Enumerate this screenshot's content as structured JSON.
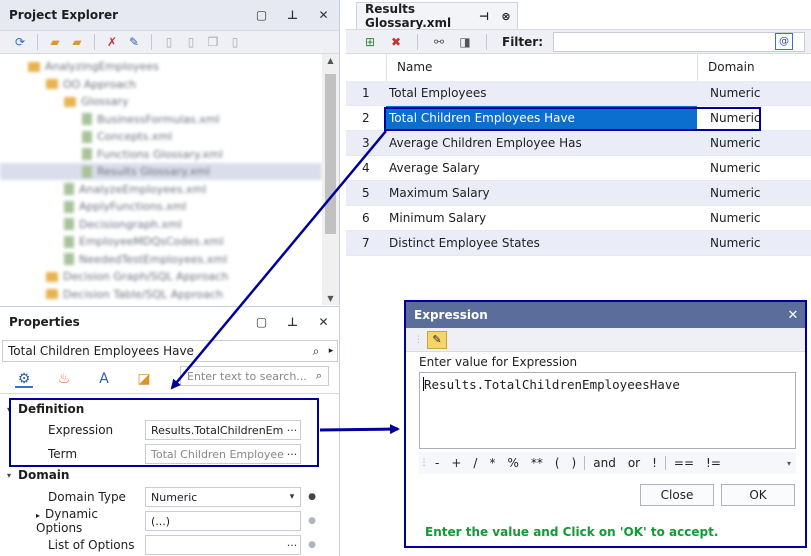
{
  "project_explorer": {
    "title": "Project Explorer",
    "header_buttons": {
      "dock_icon": "□",
      "pin_icon": "📌",
      "close_icon": "✕"
    },
    "tree_items": [
      {
        "label": "AnalyzingEmployees",
        "depth": 1,
        "kind": "folder"
      },
      {
        "label": "OO Approach",
        "depth": 2,
        "kind": "folder"
      },
      {
        "label": "Glossary",
        "depth": 3,
        "kind": "folder"
      },
      {
        "label": "BusinessFormulas.xml",
        "depth": 4,
        "kind": "file"
      },
      {
        "label": "Concepts.xml",
        "depth": 4,
        "kind": "file"
      },
      {
        "label": "Functions Glossary.xml",
        "depth": 4,
        "kind": "file"
      },
      {
        "label": "Results Glossary.xml",
        "depth": 4,
        "kind": "file"
      },
      {
        "label": "AnalyzeEmployees.xml",
        "depth": 3,
        "kind": "file"
      },
      {
        "label": "ApplyFunctions.xml",
        "depth": 3,
        "kind": "file"
      },
      {
        "label": "Decisiongraph.xml",
        "depth": 3,
        "kind": "file"
      },
      {
        "label": "EmployeeMDQsCodes.xml",
        "depth": 3,
        "kind": "file"
      },
      {
        "label": "NeededTestEmployees.xml",
        "depth": 3,
        "kind": "file"
      },
      {
        "label": "Decision Graph/SQL Approach",
        "depth": 2,
        "kind": "folder"
      },
      {
        "label": "Decision Table/SQL Approach",
        "depth": 2,
        "kind": "folder"
      }
    ]
  },
  "properties": {
    "title": "Properties",
    "selected_object": "Total Children Employees Have",
    "search_placeholder": "Enter text to search...",
    "categories": [
      {
        "name": "Definition",
        "rows": [
          {
            "name": "Expression",
            "value": "Results.TotalChildrenEmp",
            "button": "···"
          },
          {
            "name": "Term",
            "value": "Total Children Employees",
            "button": "···"
          }
        ]
      },
      {
        "name": "Domain",
        "rows": [
          {
            "name": "Domain Type",
            "value": "Numeric",
            "button": "▾"
          },
          {
            "name": "Dynamic Options",
            "value": "(...)",
            "button": ""
          },
          {
            "name": "List of Options",
            "value": "",
            "button": "···"
          }
        ]
      }
    ]
  },
  "document": {
    "tab_title": "Results Glossary.xml",
    "filter_label": "Filter:",
    "filter_value": "",
    "columns": {
      "name": "Name",
      "domain": "Domain"
    },
    "rows": [
      {
        "idx": "1",
        "name": "Total Employees",
        "domain": "Numeric"
      },
      {
        "idx": "2",
        "name": "Total Children Employees Have",
        "domain": "Numeric"
      },
      {
        "idx": "3",
        "name": "Average Children Employee Has",
        "domain": "Numeric"
      },
      {
        "idx": "4",
        "name": "Average Salary",
        "domain": "Numeric"
      },
      {
        "idx": "5",
        "name": "Maximum Salary",
        "domain": "Numeric"
      },
      {
        "idx": "6",
        "name": "Minimum Salary",
        "domain": "Numeric"
      },
      {
        "idx": "7",
        "name": "Distinct Employee States",
        "domain": "Numeric"
      }
    ]
  },
  "expression_dialog": {
    "title": "Expression",
    "label": "Enter value for Expression",
    "value": "Results.TotalChildrenEmployeesHave",
    "operators": [
      "-",
      "+",
      "/",
      "*",
      "%",
      "**",
      "(",
      ")",
      "and",
      "or",
      "!",
      "==",
      "!="
    ],
    "close_label": "Close",
    "ok_label": "OK",
    "hint": "Enter the value and Click on 'OK' to accept."
  },
  "colors": {
    "annotation": "#000099",
    "selection": "#0a6fcf",
    "hint_text": "#129a35",
    "dialog_title": "#5b6e9b"
  }
}
